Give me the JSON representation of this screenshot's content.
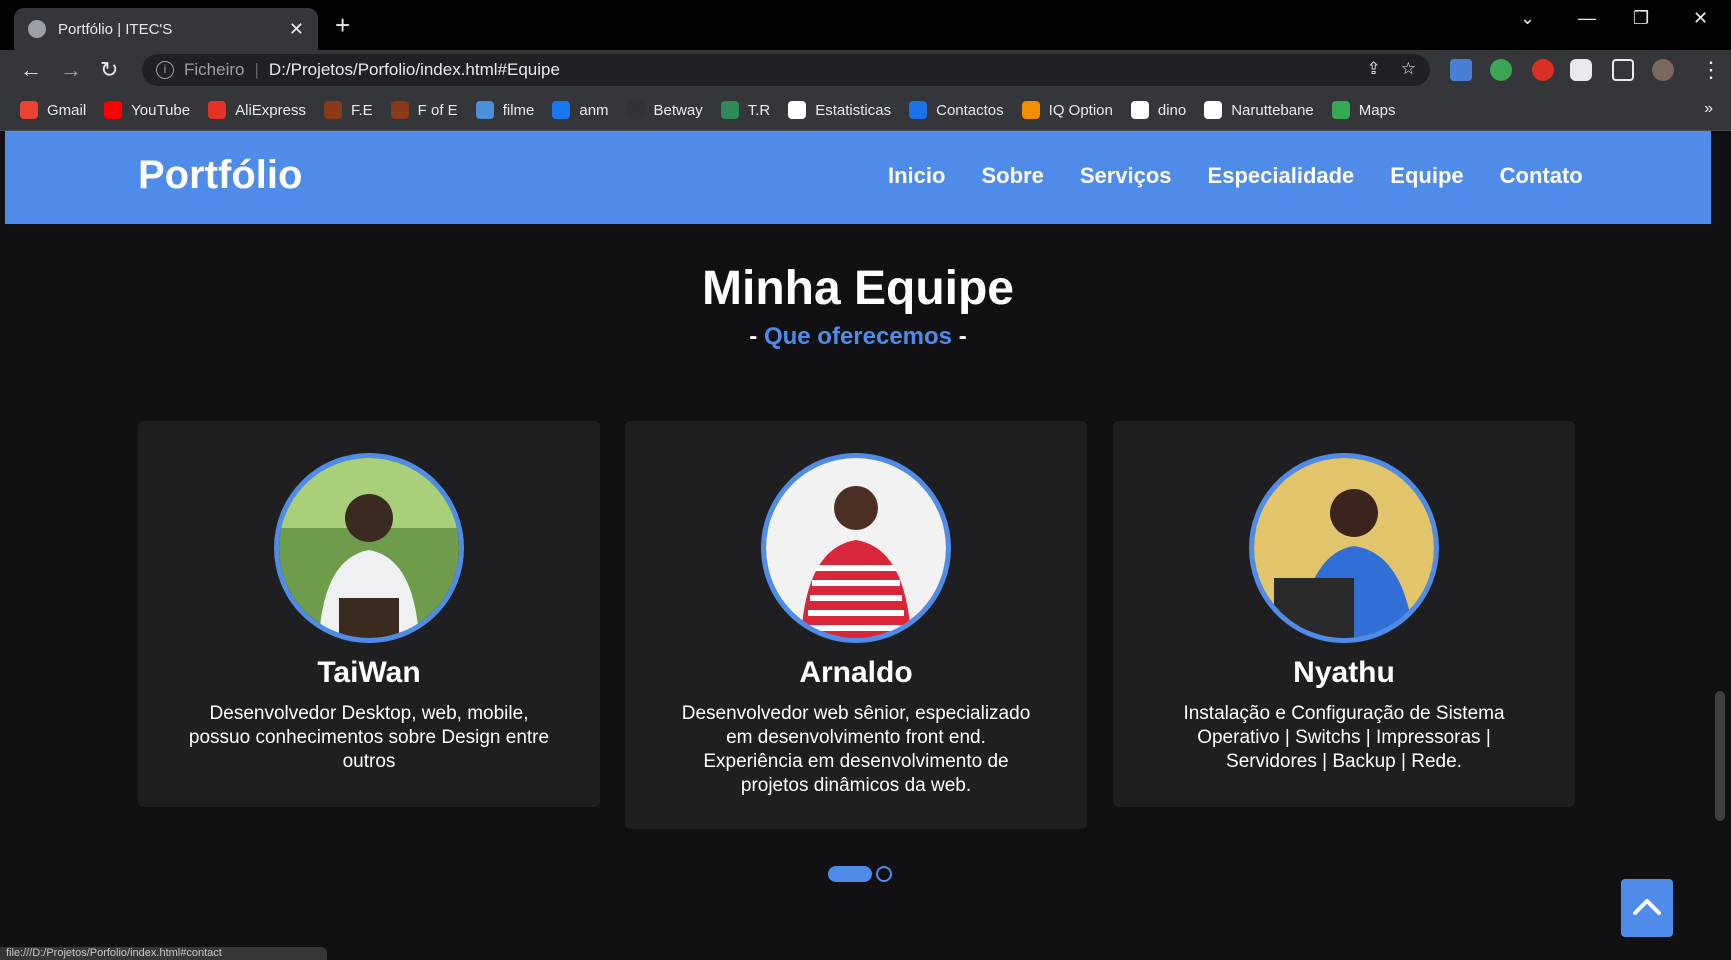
{
  "browser": {
    "tab_title": "Portfólio | ITEC'S",
    "url_scheme": "Ficheiro",
    "url": "D:/Projetos/Porfolio/index.html#Equipe",
    "bookmarks": [
      {
        "label": "Gmail",
        "icon": "gmail-icon",
        "color": "#ea4335"
      },
      {
        "label": "YouTube",
        "icon": "youtube-icon",
        "color": "#ff0000"
      },
      {
        "label": "AliExpress",
        "icon": "aliexpress-icon",
        "color": "#e43225"
      },
      {
        "label": "F.E",
        "icon": "bookmark-fe-icon",
        "color": "#8b3a1a"
      },
      {
        "label": "F of E",
        "icon": "bookmark-fofe-icon",
        "color": "#8b3a1a"
      },
      {
        "label": "filme",
        "icon": "filme-icon",
        "color": "#4a90d9"
      },
      {
        "label": "anm",
        "icon": "facebook-icon",
        "color": "#1877f2"
      },
      {
        "label": "Betway",
        "icon": "betway-icon",
        "color": "#333333"
      },
      {
        "label": "T.R",
        "icon": "tr-icon",
        "color": "#2e8b57"
      },
      {
        "label": "Estatisticas",
        "icon": "globe-icon",
        "color": "#ffffff"
      },
      {
        "label": "Contactos",
        "icon": "contacts-icon",
        "color": "#1a73e8"
      },
      {
        "label": "IQ Option",
        "icon": "iqoption-icon",
        "color": "#f28c00"
      },
      {
        "label": "dino",
        "icon": "globe-icon",
        "color": "#ffffff"
      },
      {
        "label": "Naruttebane",
        "icon": "globe-icon",
        "color": "#ffffff"
      },
      {
        "label": "Maps",
        "icon": "maps-icon",
        "color": "#34a853"
      }
    ],
    "status_url": "file:///D:/Projetos/Porfolio/index.html#contact"
  },
  "site": {
    "brand": "Portfólio",
    "nav": [
      "Inicio",
      "Sobre",
      "Serviços",
      "Especialidade",
      "Equipe",
      "Contato"
    ],
    "section_title": "Minha Equipe",
    "section_sub_prefix": "- ",
    "section_sub": "Que oferecemos",
    "section_sub_suffix": " -",
    "team": [
      {
        "name": "TaiWan",
        "desc": "Desenvolvedor Desktop, web, mobile, possuo conhecimentos sobre Design entre outros"
      },
      {
        "name": "Arnaldo",
        "desc": "Desenvolvedor web sênior, especializado em desenvolvimento front end. Experiência em desenvolvimento de projetos dinâmicos da web."
      },
      {
        "name": "Nyathu",
        "desc": "Instalação e Configuração de Sistema Operativo | Switchs | Impressoras | Servidores | Backup | Rede."
      }
    ]
  },
  "colors": {
    "accent": "#4f8be8",
    "background": "#111113",
    "card": "#1f1f22"
  }
}
